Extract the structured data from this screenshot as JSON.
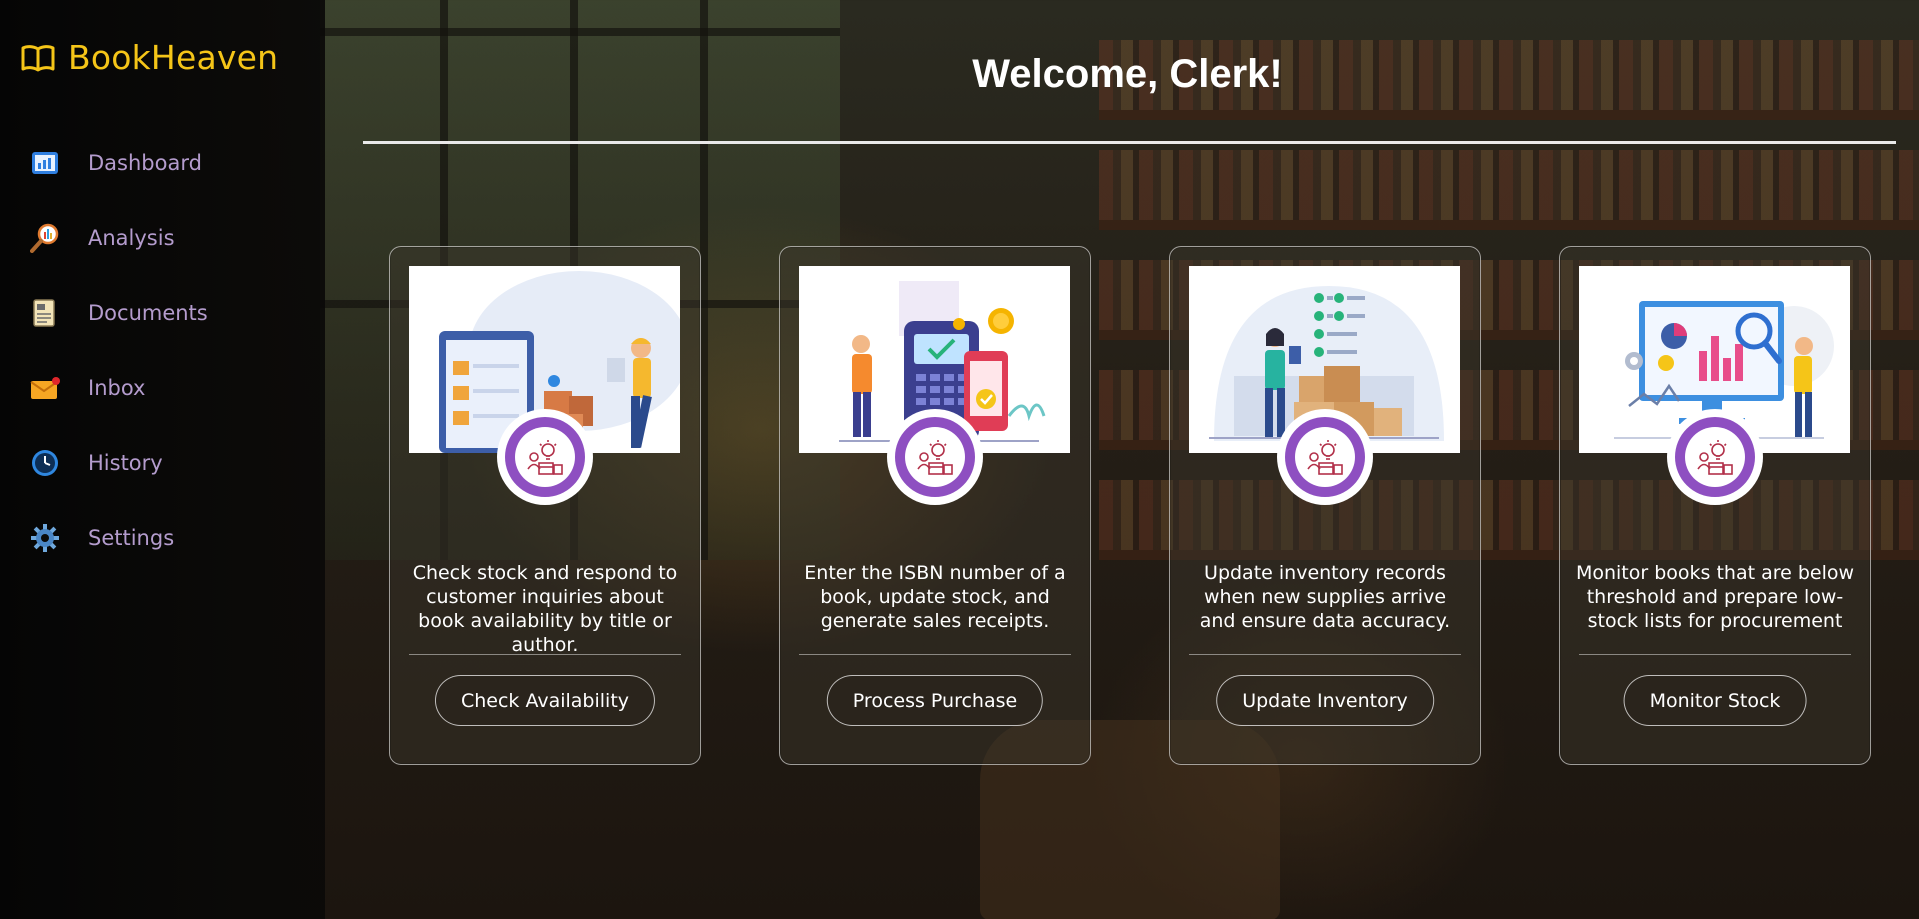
{
  "app": {
    "brand": "BookHeaven",
    "brand_color": "#f5c518",
    "accent_color": "#8e4fc1",
    "nav_label_color": "#b49ccd"
  },
  "sidebar": {
    "items": [
      {
        "label": "Dashboard",
        "icon": "bar-chart-icon"
      },
      {
        "label": "Analysis",
        "icon": "magnifier-chart-icon"
      },
      {
        "label": "Documents",
        "icon": "document-icon"
      },
      {
        "label": "Inbox",
        "icon": "envelope-icon"
      },
      {
        "label": "History",
        "icon": "clock-icon"
      },
      {
        "label": "Settings",
        "icon": "gear-icon"
      }
    ]
  },
  "header": {
    "title": "Welcome, Clerk!"
  },
  "cards": [
    {
      "illustration": "warehouse-worker-illustration",
      "badge_icon": "idea-box-icon",
      "description": "Check stock and respond to customer inquiries about book availability by title or author.",
      "button": "Check Availability"
    },
    {
      "illustration": "payment-terminal-illustration",
      "badge_icon": "idea-box-icon",
      "description": "Enter the ISBN number of a book, update stock, and generate sales receipts.",
      "button": "Process Purchase"
    },
    {
      "illustration": "inventory-checklist-illustration",
      "badge_icon": "idea-box-icon",
      "description": "Update inventory records when new supplies arrive and ensure data accuracy.",
      "button": "Update Inventory"
    },
    {
      "illustration": "analytics-monitor-illustration",
      "badge_icon": "idea-box-icon",
      "description": "Monitor books that are below threshold and prepare low-stock lists for procurement",
      "button": "Monitor Stock"
    }
  ]
}
